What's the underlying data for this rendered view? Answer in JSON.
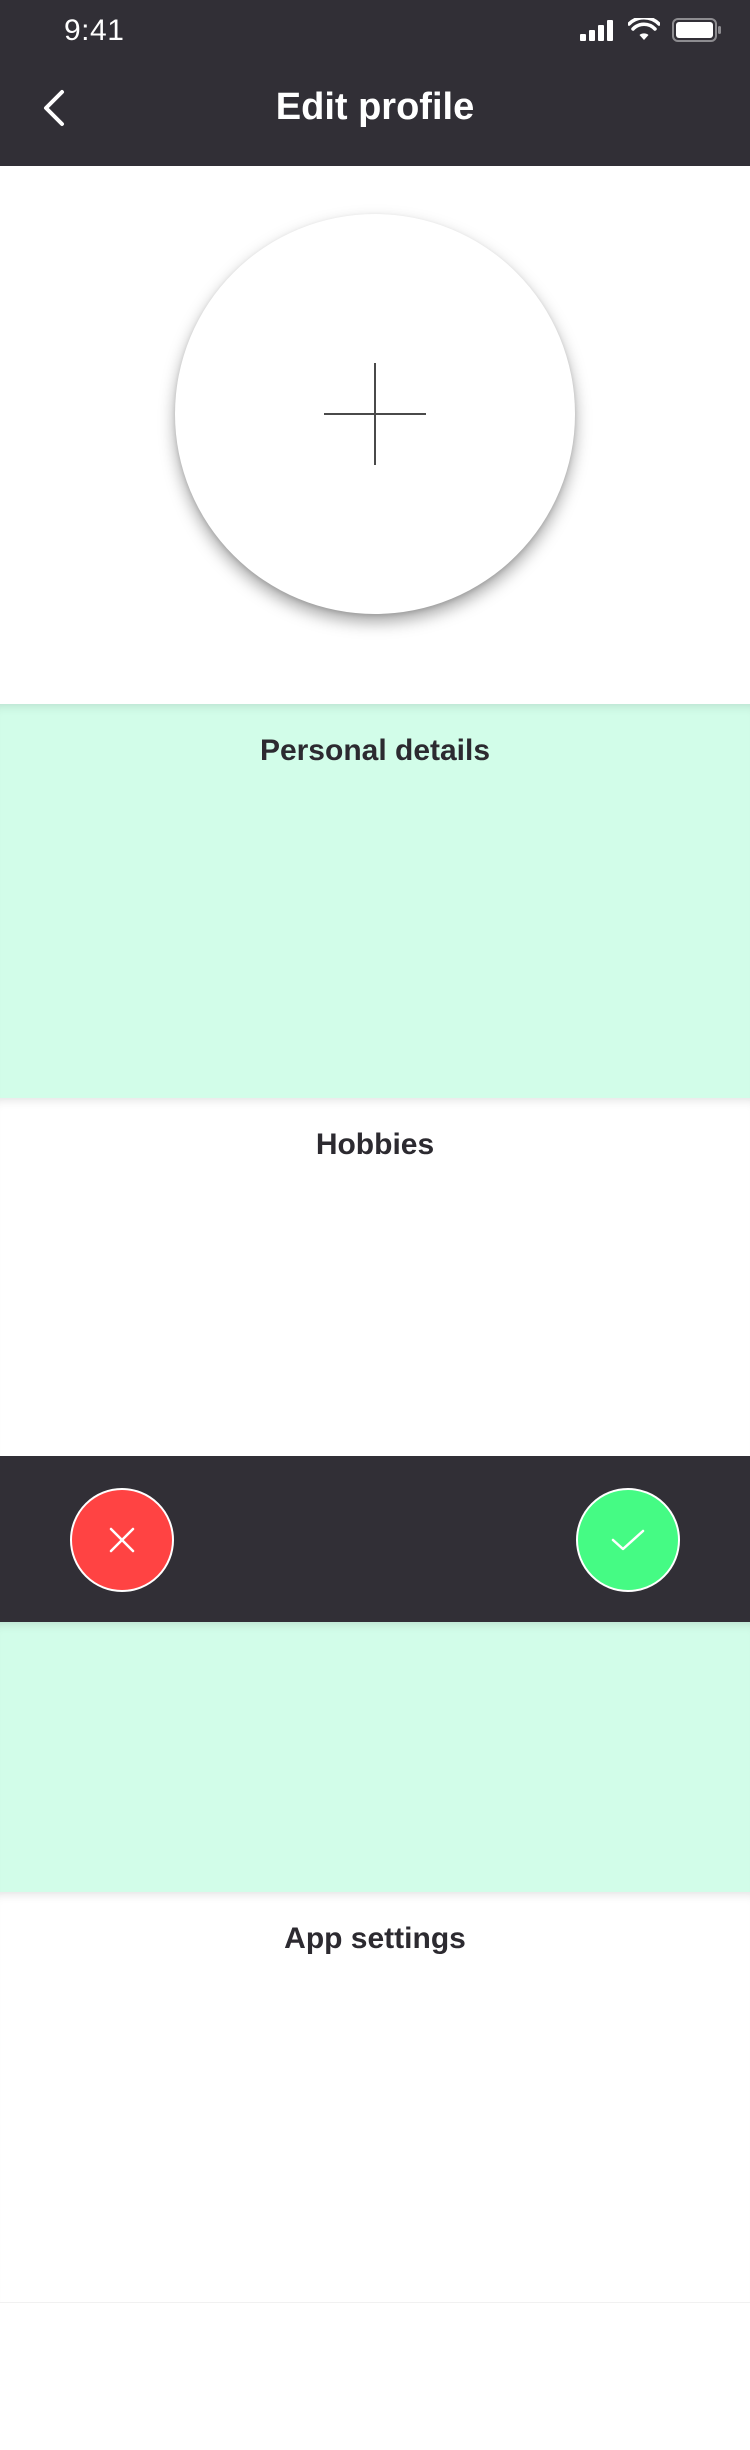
{
  "status_bar": {
    "time": "9:41"
  },
  "header": {
    "title": "Edit profile"
  },
  "sections": {
    "personal": {
      "title": "Personal details"
    },
    "hobbies": {
      "title": "Hobbies"
    },
    "app_settings": {
      "title": "App settings"
    }
  },
  "colors": {
    "header_bg": "#312f36",
    "mint": "#d2fde9",
    "cancel": "#ff4343",
    "confirm": "#45fb84"
  },
  "icons": {
    "back": "chevron-left-icon",
    "avatar_add": "plus-icon",
    "cancel": "close-icon",
    "confirm": "check-icon"
  }
}
